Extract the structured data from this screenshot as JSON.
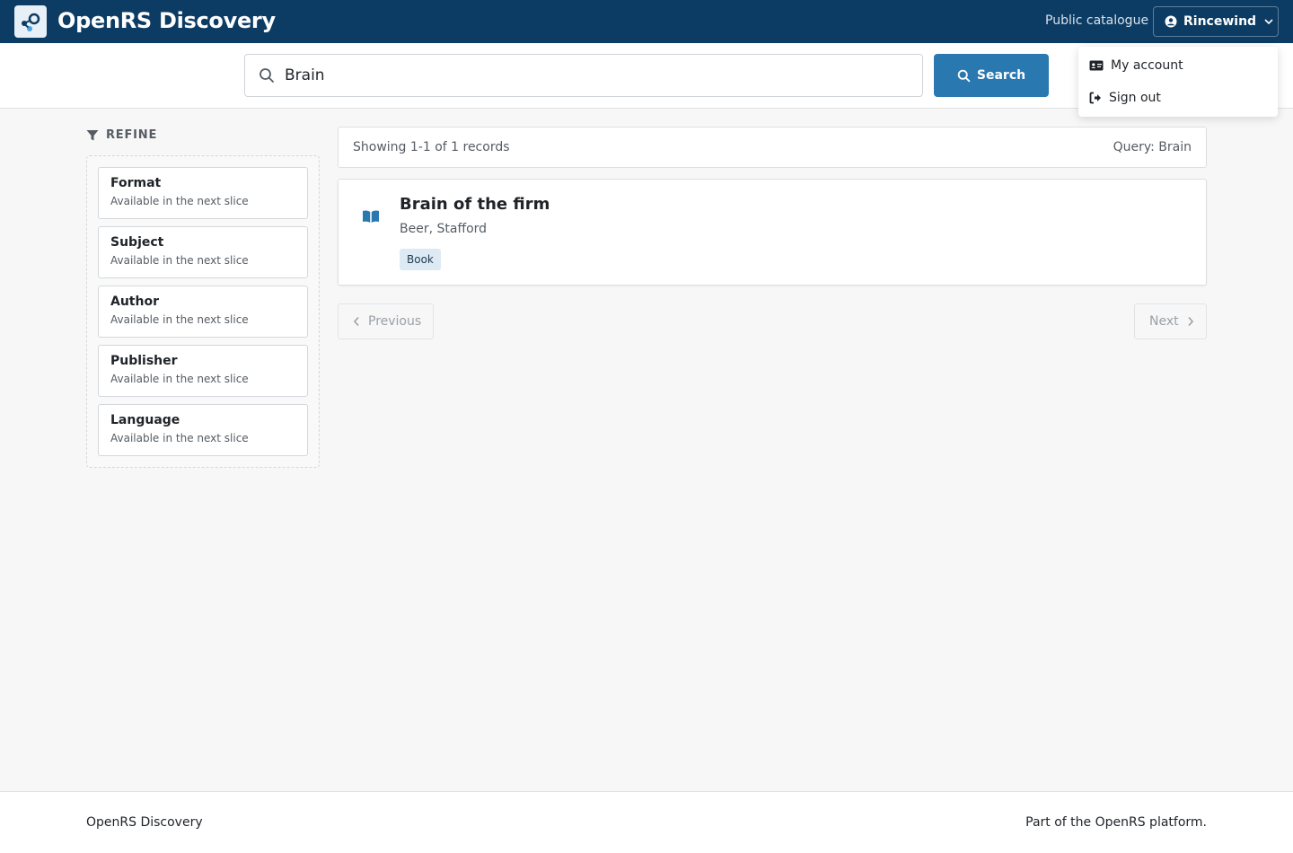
{
  "header": {
    "brand": "OpenRS Discovery",
    "public_catalogue": "Public catalogue",
    "user_name": "Rincewind"
  },
  "user_menu": {
    "items": [
      {
        "label": "My account",
        "icon": "id-card-icon"
      },
      {
        "label": "Sign out",
        "icon": "sign-out-icon"
      }
    ]
  },
  "search": {
    "value": "Brain",
    "button_label": "Search"
  },
  "sidebar": {
    "title": "REFINE",
    "facets": [
      {
        "title": "Format",
        "subtitle": "Available in the next slice"
      },
      {
        "title": "Subject",
        "subtitle": "Available in the next slice"
      },
      {
        "title": "Author",
        "subtitle": "Available in the next slice"
      },
      {
        "title": "Publisher",
        "subtitle": "Available in the next slice"
      },
      {
        "title": "Language",
        "subtitle": "Available in the next slice"
      }
    ]
  },
  "results": {
    "summary": "Showing 1-1 of 1 records",
    "query": "Query: Brain",
    "records": [
      {
        "title": "Brain of the firm",
        "author": "Beer, Stafford",
        "format": "Book",
        "icon": "open-book-icon"
      }
    ]
  },
  "pagination": {
    "previous": "Previous",
    "next": "Next"
  },
  "footer": {
    "left": "OpenRS Discovery",
    "right": "Part of the OpenRS platform."
  },
  "colors": {
    "header_bg": "#0c3b63",
    "accent": "#2978b0",
    "badge_bg": "#dde9f3"
  }
}
